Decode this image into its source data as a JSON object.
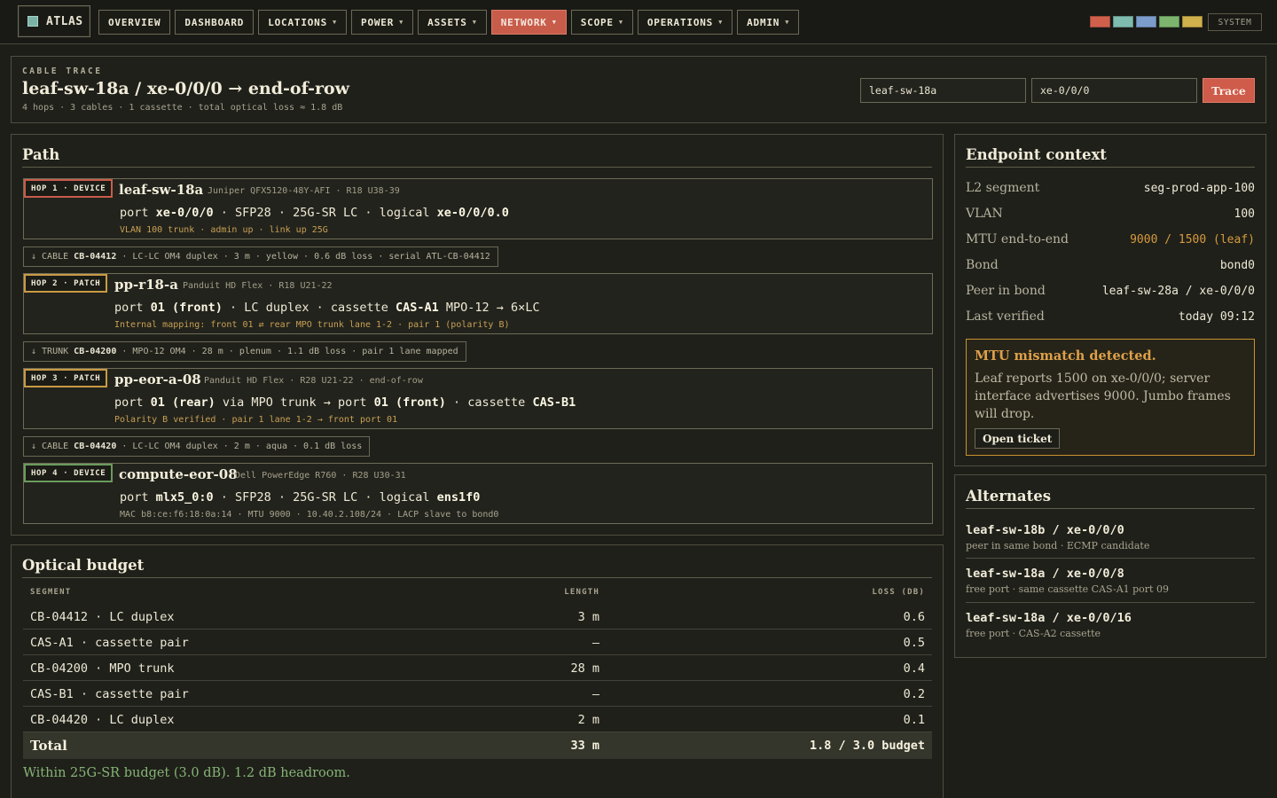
{
  "nav": {
    "brand": "ATLAS",
    "items": [
      {
        "label": "OVERVIEW",
        "dropdown": false,
        "active": false
      },
      {
        "label": "DASHBOARD",
        "dropdown": false,
        "active": false
      },
      {
        "label": "LOCATIONS",
        "dropdown": true,
        "active": false
      },
      {
        "label": "POWER",
        "dropdown": true,
        "active": false
      },
      {
        "label": "ASSETS",
        "dropdown": true,
        "active": false
      },
      {
        "label": "NETWORK",
        "dropdown": true,
        "active": true
      },
      {
        "label": "SCOPE",
        "dropdown": true,
        "active": false
      },
      {
        "label": "OPERATIONS",
        "dropdown": true,
        "active": false
      },
      {
        "label": "ADMIN",
        "dropdown": true,
        "active": false
      }
    ],
    "swatches": [
      "#d0604c",
      "#7fbcb0",
      "#7c9ccb",
      "#7db56e",
      "#cfb04c"
    ],
    "system_label": "SYSTEM"
  },
  "trace": {
    "eyebrow": "CABLE TRACE",
    "title": "leaf-sw-18a / xe-0/0/0 → end-of-row",
    "subtitle": "4 hops · 3 cables · 1 cassette · total optical loss ≈ 1.8 dB",
    "device_value": "leaf-sw-18a",
    "port_value": "xe-0/0/0",
    "button_label": "Trace"
  },
  "path": {
    "title": "Path",
    "hops": [
      {
        "badge": "HOP 1 · DEVICE",
        "name": "leaf-sw-18a",
        "meta": "Juniper QFX5120-48Y-AFI · R18 U38-39",
        "port_parts": [
          {
            "t": "port ",
            "b": false
          },
          {
            "t": "xe-0/0/0",
            "b": true
          },
          {
            "t": " · SFP28 · 25G-SR LC · logical ",
            "b": false
          },
          {
            "t": "xe-0/0/0.0",
            "b": true
          }
        ],
        "detail": "VLAN 100 trunk · admin up · link up 25G"
      },
      {
        "badge": "HOP 2 · PATCH",
        "name": "pp-r18-a",
        "meta": "Panduit HD Flex · R18 U21-22",
        "port_parts": [
          {
            "t": "port ",
            "b": false
          },
          {
            "t": "01 (front)",
            "b": true
          },
          {
            "t": " · LC duplex · cassette ",
            "b": false
          },
          {
            "t": "CAS-A1",
            "b": true
          },
          {
            "t": " MPO-12 → 6×LC",
            "b": false
          }
        ],
        "detail": "Internal mapping: front 01 ⇄ rear MPO trunk lane 1-2 · pair 1 (polarity B)"
      },
      {
        "badge": "HOP 3 · PATCH",
        "name": "pp-eor-a-08",
        "meta": "Panduit HD Flex · R28 U21-22 · end-of-row",
        "port_parts": [
          {
            "t": "port ",
            "b": false
          },
          {
            "t": "01 (rear)",
            "b": true
          },
          {
            "t": " via MPO trunk → port ",
            "b": false
          },
          {
            "t": "01 (front)",
            "b": true
          },
          {
            "t": " · cassette ",
            "b": false
          },
          {
            "t": "CAS-B1",
            "b": true
          }
        ],
        "detail": "Polarity B verified · pair 1 lane 1-2 → front port 01"
      },
      {
        "badge": "HOP 4 · DEVICE",
        "name": "compute-eor-08",
        "meta": "Dell PowerEdge R760 · R28 U30-31",
        "port_parts": [
          {
            "t": "port ",
            "b": false
          },
          {
            "t": "mlx5_0:0",
            "b": true
          },
          {
            "t": " · SFP28 · 25G-SR LC · logical ",
            "b": false
          },
          {
            "t": "ens1f0",
            "b": true
          }
        ],
        "detail": "MAC b8:ce:f6:18:0a:14 · MTU 9000 · 10.40.2.108/24 · LACP slave to bond0"
      }
    ],
    "cables": [
      {
        "prefix": "↓ CABLE ",
        "id": "CB-04412",
        "text": " · LC-LC OM4 duplex · 3 m · yellow · 0.6 dB loss · serial ATL-CB-04412"
      },
      {
        "prefix": "↓ TRUNK ",
        "id": "CB-04200",
        "text": " · MPO-12 OM4 · 28 m · plenum · 1.1 dB loss · pair 1 lane mapped"
      },
      {
        "prefix": "↓ CABLE ",
        "id": "CB-04420",
        "text": " · LC-LC OM4 duplex · 2 m · aqua · 0.1 dB loss"
      }
    ]
  },
  "context": {
    "title": "Endpoint context",
    "rows": [
      {
        "key": "L2 segment",
        "value": "seg-prod-app-100",
        "warn": false
      },
      {
        "key": "VLAN",
        "value": "100",
        "warn": false
      },
      {
        "key": "MTU end-to-end",
        "value": "9000 / 1500 (leaf)",
        "warn": true
      },
      {
        "key": "Bond",
        "value": "bond0",
        "warn": false
      },
      {
        "key": "Peer in bond",
        "value": "leaf-sw-28a / xe-0/0/0",
        "warn": false
      },
      {
        "key": "Last verified",
        "value": "today 09:12",
        "warn": false
      }
    ],
    "alert": {
      "title": "MTU mismatch detected.",
      "body": "Leaf reports 1500 on xe-0/0/0; server interface advertises 9000. Jumbo frames will drop.",
      "button": "Open ticket"
    }
  },
  "alternates": {
    "title": "Alternates",
    "items": [
      {
        "name": "leaf-sw-18b / xe-0/0/0",
        "desc": "peer in same bond · ECMP candidate"
      },
      {
        "name": "leaf-sw-18a / xe-0/0/8",
        "desc": "free port · same cassette CAS-A1 port 09"
      },
      {
        "name": "leaf-sw-18a / xe-0/0/16",
        "desc": "free port · CAS-A2 cassette"
      }
    ]
  },
  "budget": {
    "title": "Optical budget",
    "columns": {
      "segment": "SEGMENT",
      "length": "LENGTH",
      "loss": "LOSS (DB)"
    },
    "rows": [
      {
        "segment": "CB-04412 · LC duplex",
        "length": "3 m",
        "loss": "0.6"
      },
      {
        "segment": "CAS-A1 · cassette pair",
        "length": "–",
        "loss": "0.5"
      },
      {
        "segment": "CB-04200 · MPO trunk",
        "length": "28 m",
        "loss": "0.4"
      },
      {
        "segment": "CAS-B1 · cassette pair",
        "length": "–",
        "loss": "0.2"
      },
      {
        "segment": "CB-04420 · LC duplex",
        "length": "2 m",
        "loss": "0.1"
      }
    ],
    "total": {
      "label": "Total",
      "length": "33 m",
      "loss": "1.8 / 3.0 budget"
    },
    "note": "Within 25G-SR budget (3.0 dB). 1.2 dB headroom."
  }
}
